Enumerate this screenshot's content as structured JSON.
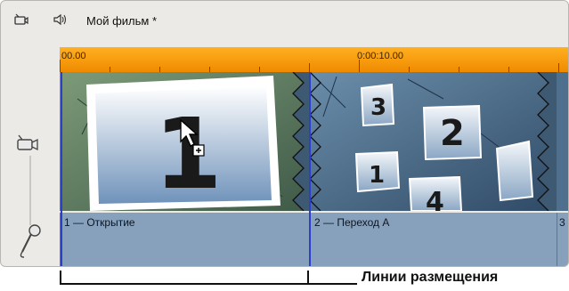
{
  "app": {
    "title": "Мой фильм *",
    "icons": [
      "video-track-icon",
      "audio-track-icon",
      "video-track-icon",
      "microphone-icon"
    ]
  },
  "ruler": {
    "start_label": "00.00",
    "mid_label": "0:00:10.00"
  },
  "clips": [
    {
      "label": "1 — Открытие",
      "thumbnail": "opening-menu-1"
    },
    {
      "label": "2 — Переход A",
      "thumbnail": "transition-photos"
    },
    {
      "label": "3",
      "thumbnail": "partial-clip"
    }
  ],
  "annotation": {
    "caption": "Линии размещения"
  },
  "colors": {
    "ruler": "#f59500",
    "video_track": "#3e5972",
    "title_track": "#87a1bd",
    "placement_line": "#2a40c8"
  }
}
